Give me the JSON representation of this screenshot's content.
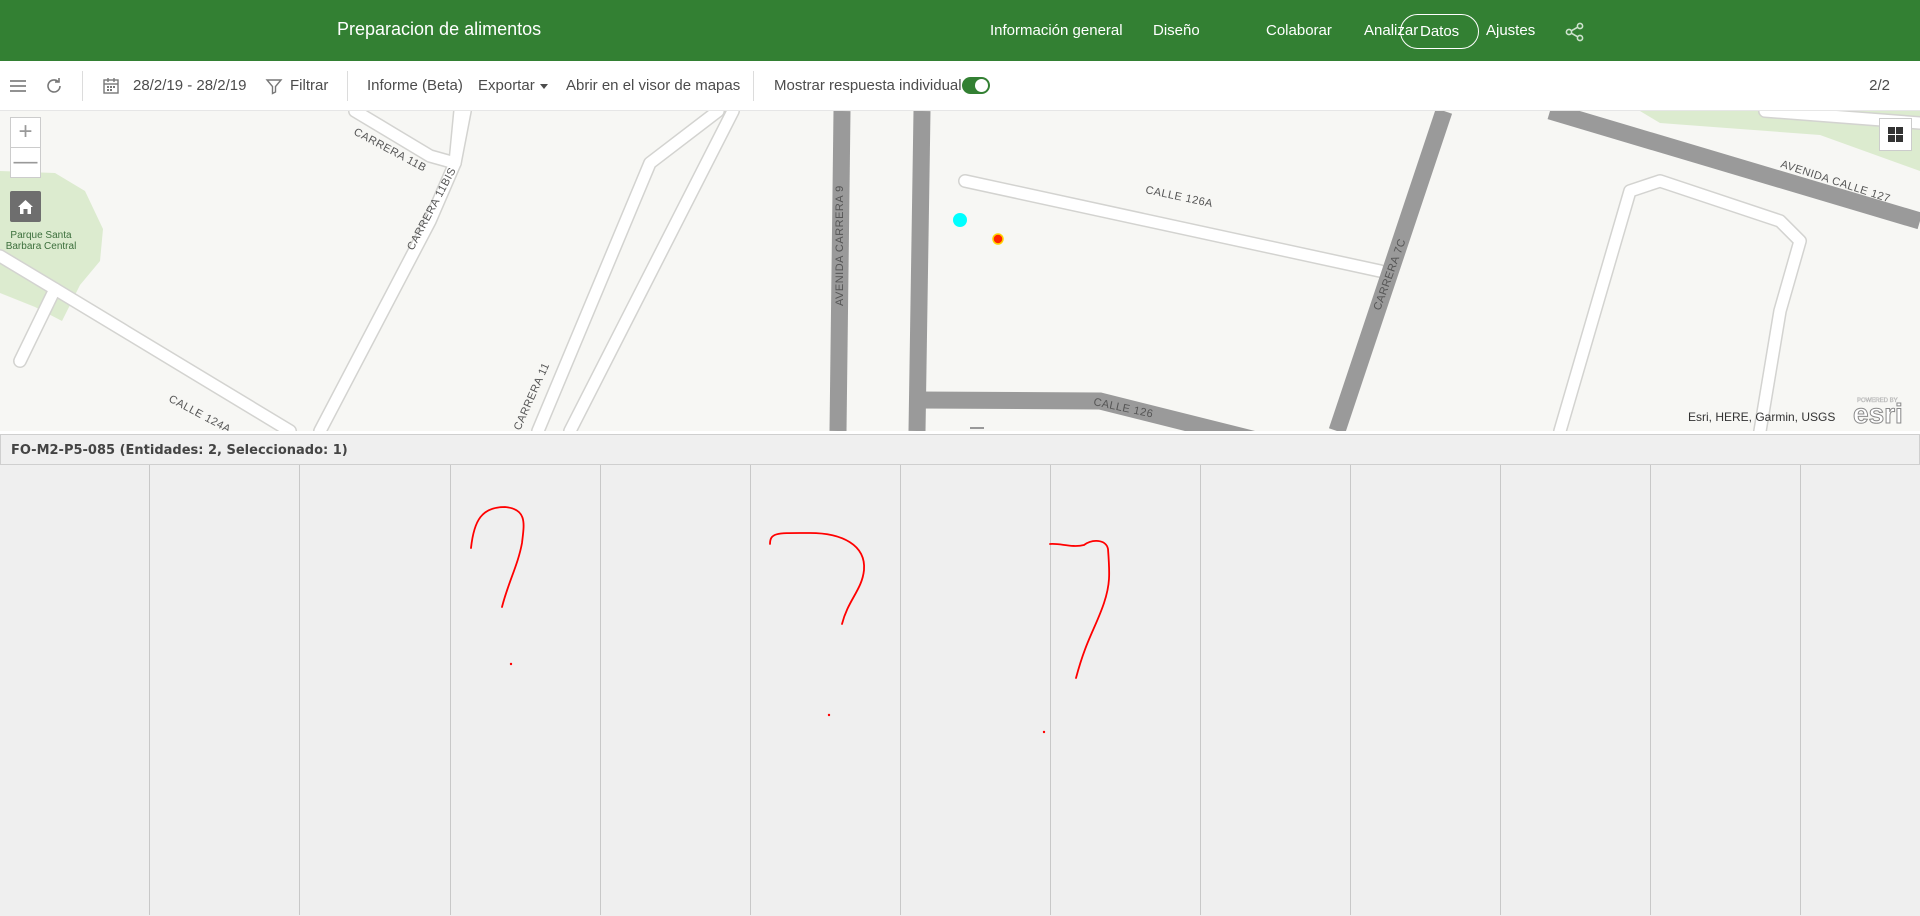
{
  "header": {
    "title": "Preparacion de alimentos",
    "nav": [
      "Información general",
      "Diseño",
      "Colaborar",
      "Analizar",
      "Datos",
      "Ajustes"
    ],
    "active_nav": "Datos",
    "share_icon": "share-icon"
  },
  "toolbar": {
    "menu_icon": "hamburger-icon",
    "refresh_icon": "refresh-icon",
    "date_range": "28/2/19 - 28/2/19",
    "filter_label": "Filtrar",
    "report_label": "Informe (Beta)",
    "export_label": "Exportar",
    "open_map_label": "Abrir en el visor de mapas",
    "individual_label": "Mostrar respuesta individual",
    "individual_on": true,
    "page_count": "2/2"
  },
  "map": {
    "zoom_in": "+",
    "zoom_out": "—",
    "park_label": "Parque Santa Barbara Central",
    "streets": [
      "CARRERA 11B",
      "CARRERA 11BIS",
      "CALLE 124A",
      "CARRERA 11",
      "AVENIDA CARRERA 9",
      "CALLE 126A",
      "CARRERA 7C",
      "CALLE 126",
      "AVENIDA CALLE 127"
    ],
    "attribution": "Esri, HERE, Garmin, USGS",
    "logo_small": "POWERED BY",
    "logo": "esri",
    "point_colors": [
      "#00ffff",
      "#ff2600"
    ]
  },
  "table": {
    "title": "FO-M2-P5-085 (Entidades: 2, Seleccionado: 1)",
    "column_count": 13
  }
}
